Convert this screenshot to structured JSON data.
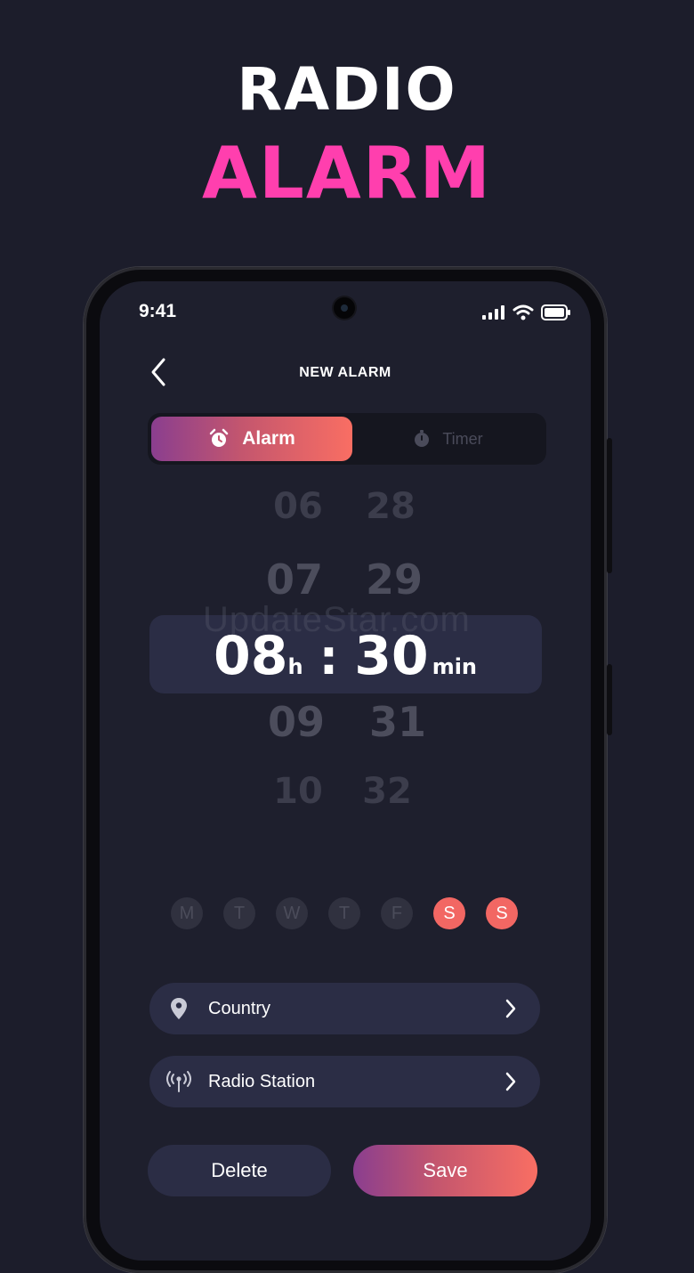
{
  "hero": {
    "line1": "RADIO",
    "line2": "ALARM"
  },
  "status_bar": {
    "time": "9:41"
  },
  "header": {
    "title": "NEW ALARM"
  },
  "mode_tabs": [
    {
      "label": "Alarm",
      "icon": "alarm-clock-icon",
      "active": true
    },
    {
      "label": "Timer",
      "icon": "stopwatch-icon",
      "active": false
    }
  ],
  "time_picker": {
    "hours_above": [
      "06",
      "07"
    ],
    "minutes_above": [
      "28",
      "29"
    ],
    "selected_hour": "08",
    "hour_unit": "h",
    "separator": ":",
    "selected_minute": "30",
    "minute_unit": "min",
    "hours_below": [
      "09",
      "10"
    ],
    "minutes_below": [
      "31",
      "32"
    ]
  },
  "watermark": "UpdateStar.com",
  "days": [
    {
      "label": "M",
      "active": false
    },
    {
      "label": "T",
      "active": false
    },
    {
      "label": "W",
      "active": false
    },
    {
      "label": "T",
      "active": false
    },
    {
      "label": "F",
      "active": false
    },
    {
      "label": "S",
      "active": true
    },
    {
      "label": "S",
      "active": true
    }
  ],
  "settings": [
    {
      "label": "Country",
      "icon": "location-pin-icon"
    },
    {
      "label": "Radio Station",
      "icon": "radio-broadcast-icon"
    }
  ],
  "actions": {
    "delete_label": "Delete",
    "save_label": "Save"
  },
  "colors": {
    "background": "#1c1d2b",
    "accent_pink": "#ff3fae",
    "accent_coral": "#f96e63",
    "accent_purple": "#8a3e8f"
  }
}
